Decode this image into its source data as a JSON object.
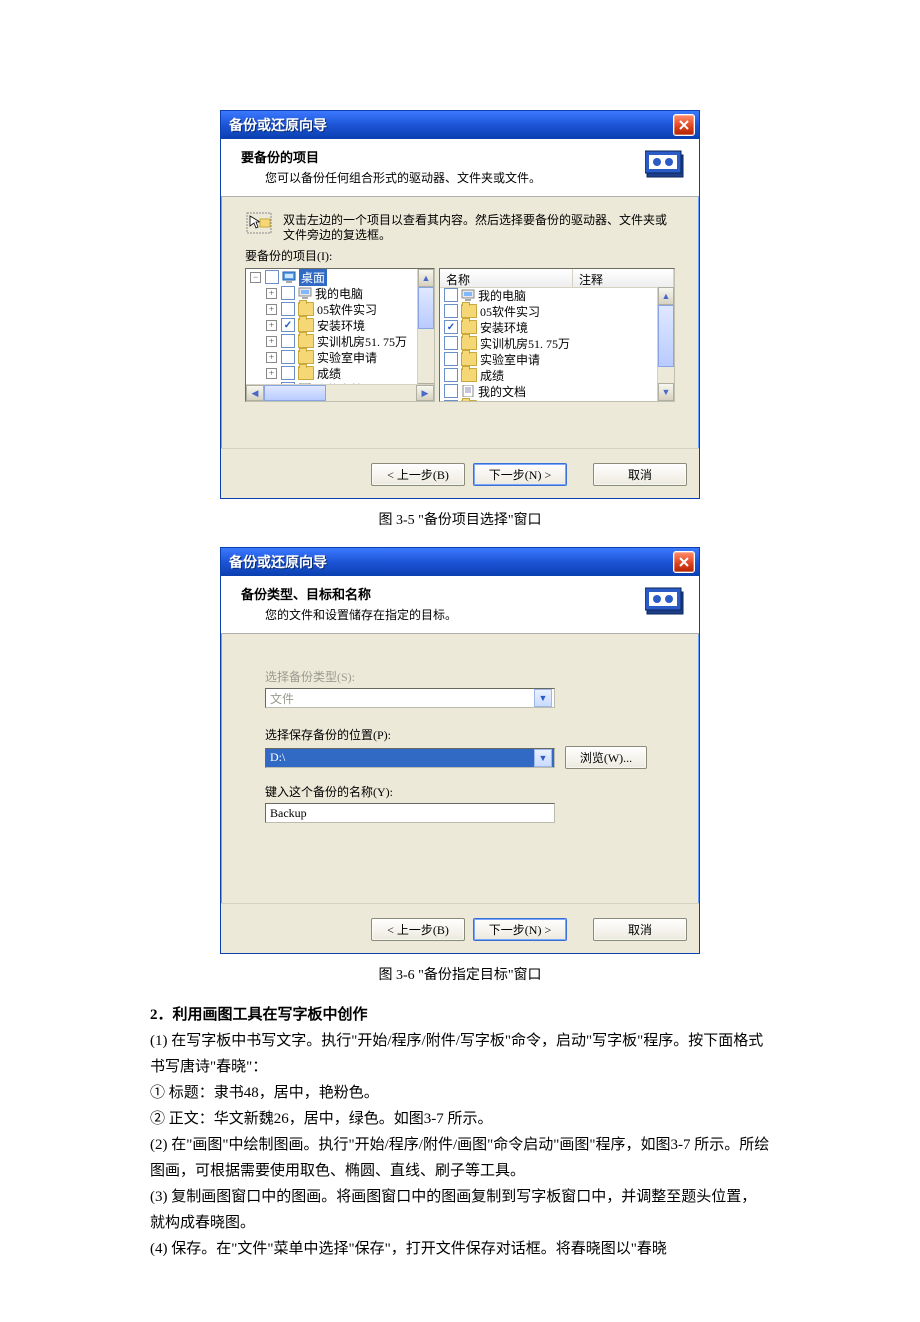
{
  "win1": {
    "title": "备份或还原向导",
    "header_title": "要备份的项目",
    "header_sub": "您可以备份任何组合形式的驱动器、文件夹或文件。",
    "hint": "双击左边的一个项目以查看其内容。然后选择要备份的驱动器、文件夹或文件旁边的复选框。",
    "items_label": "要备份的项目(I):",
    "tree": {
      "root": "桌面",
      "children": [
        {
          "label": "我的电脑",
          "type": "pc"
        },
        {
          "label": "05软件实习",
          "type": "folder"
        },
        {
          "label": "安装环境",
          "type": "folder",
          "checked": true
        },
        {
          "label": "实训机房51. 75万",
          "type": "folder"
        },
        {
          "label": "实验室申请",
          "type": "folder"
        },
        {
          "label": "成绩",
          "type": "folder"
        },
        {
          "label": "我的文档",
          "type": "doc"
        }
      ]
    },
    "list_cols": {
      "name": "名称",
      "comment": "注释"
    },
    "list": [
      {
        "label": "我的电脑",
        "type": "pc"
      },
      {
        "label": "05软件实习",
        "type": "folder"
      },
      {
        "label": "安装环境",
        "type": "folder",
        "checked": true
      },
      {
        "label": "实训机房51. 75万",
        "type": "folder"
      },
      {
        "label": "实验室申请",
        "type": "folder"
      },
      {
        "label": "成绩",
        "type": "folder"
      },
      {
        "label": "我的文档",
        "type": "doc"
      },
      {
        "label": "教材",
        "type": "folder"
      }
    ],
    "buttons": {
      "back": "< 上一步(B)",
      "next": "下一步(N) >",
      "cancel": "取消"
    }
  },
  "caption1": "图 3-5  \"备份项目选择\"窗口",
  "win2": {
    "title": "备份或还原向导",
    "header_title": "备份类型、目标和名称",
    "header_sub": "您的文件和设置储存在指定的目标。",
    "type_label": "选择备份类型(S):",
    "type_value": "文件",
    "loc_label": "选择保存备份的位置(P):",
    "loc_value": "D:\\",
    "browse": "浏览(W)...",
    "name_label": "键入这个备份的名称(Y):",
    "name_value": "Backup",
    "buttons": {
      "back": "< 上一步(B)",
      "next": "下一步(N) >",
      "cancel": "取消"
    }
  },
  "caption2": "图 3-6  \"备份指定目标\"窗口",
  "para": {
    "h": "2．利用画图工具在写字板中创作",
    "l1": "(1) 在写字板中书写文字。执行\"开始/程序/附件/写字板\"命令，启动\"写字板\"程序。按下面格式书写唐诗\"春晓\"：",
    "l2": "① 标题：隶书48，居中，艳粉色。",
    "l3": "② 正文：华文新魏26，居中，绿色。如图3-7 所示。",
    "l4": "(2) 在\"画图\"中绘制图画。执行\"开始/程序/附件/画图\"命令启动\"画图\"程序，如图3-7 所示。所绘图画，可根据需要使用取色、椭圆、直线、刷子等工具。",
    "l5": "(3) 复制画图窗口中的图画。将画图窗口中的图画复制到写字板窗口中，并调整至题头位置，就构成春晓图。",
    "l6": "(4) 保存。在\"文件\"菜单中选择\"保存\"，打开文件保存对话框。将春晓图以\"春晓"
  }
}
